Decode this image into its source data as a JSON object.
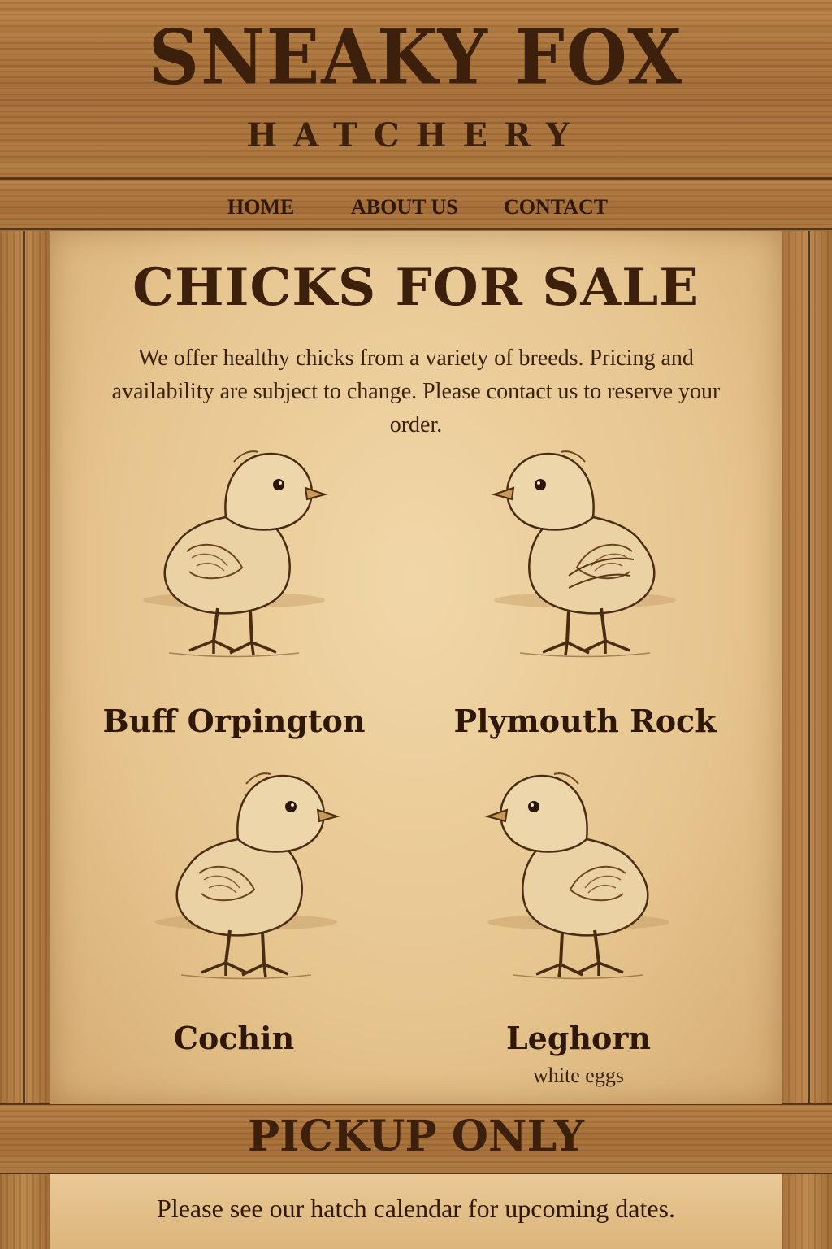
{
  "brand": {
    "title": "SNEAKY FOX",
    "subtitle": "HATCHERY"
  },
  "nav": {
    "items": [
      {
        "label": "HOME"
      },
      {
        "label": "ABOUT US"
      },
      {
        "label": "CONTACT"
      }
    ]
  },
  "main": {
    "title": "CHICKS FOR SALE",
    "intro": "We offer healthy chicks from a variety of breeds. Pricing and availability are subject to change. Please contact us to reserve your order.",
    "breeds": [
      {
        "name": "Buff Orpington",
        "note": ""
      },
      {
        "name": "Plymouth Rock",
        "note": ""
      },
      {
        "name": "Cochin",
        "note": ""
      },
      {
        "name": "Leghorn",
        "note": "white eggs"
      }
    ]
  },
  "footer": {
    "banner": "PICKUP ONLY",
    "note": "Please see our hatch calendar for upcoming dates."
  },
  "colors": {
    "wood": "#a8733f",
    "paper": "#e6c48e",
    "ink": "#3d200b"
  },
  "icons": [
    "chick-illustration"
  ]
}
